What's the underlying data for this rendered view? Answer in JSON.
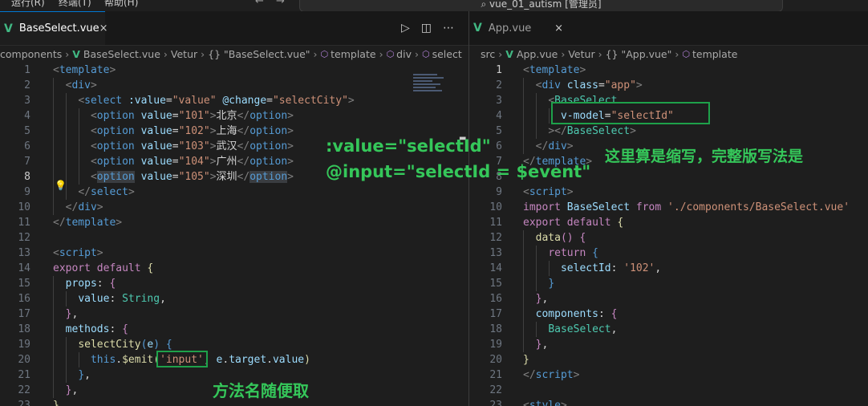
{
  "titlebar": {
    "menu_run": "运行(R)",
    "menu_terminal": "终端(T)",
    "menu_help": "帮助(H)",
    "back_icon": "←",
    "forward_icon": "→",
    "command_center": "vue_01_autism [管理员]"
  },
  "left": {
    "tab_label": "BaseSelect.vue",
    "tab_close": "×",
    "breadcrumb": [
      "components",
      "BaseSelect.vue",
      "Vetur",
      "{} \"BaseSelect.vue\"",
      "template",
      "div",
      "select"
    ],
    "lines": [
      {
        "n": "1",
        "html": "<span class=\"tg\">&lt;</span><span class=\"tn\">template</span><span class=\"tg\">&gt;</span>"
      },
      {
        "n": "2",
        "html": "  <span class=\"tg\">&lt;</span><span class=\"tn\">div</span><span class=\"tg\">&gt;</span>"
      },
      {
        "n": "3",
        "html": "    <span class=\"tg\">&lt;</span><span class=\"tn\">select</span> <span class=\"at\">:value</span><span class=\"tx\">=</span><span class=\"st\">\"value\"</span> <span class=\"at\">@change</span><span class=\"tx\">=</span><span class=\"st\">\"selectCity\"</span><span class=\"tg\">&gt;</span>"
      },
      {
        "n": "4",
        "html": "      <span class=\"tg\">&lt;</span><span class=\"tn\">option</span> <span class=\"at\">value</span><span class=\"tx\">=</span><span class=\"st\">\"101\"</span><span class=\"tg\">&gt;</span><span class=\"tx\">北京</span><span class=\"tg\">&lt;/</span><span class=\"tn\">option</span><span class=\"tg\">&gt;</span>"
      },
      {
        "n": "5",
        "html": "      <span class=\"tg\">&lt;</span><span class=\"tn\">option</span> <span class=\"at\">value</span><span class=\"tx\">=</span><span class=\"st\">\"102\"</span><span class=\"tg\">&gt;</span><span class=\"tx\">上海</span><span class=\"tg\">&lt;/</span><span class=\"tn\">option</span><span class=\"tg\">&gt;</span>"
      },
      {
        "n": "6",
        "html": "      <span class=\"tg\">&lt;</span><span class=\"tn\">option</span> <span class=\"at\">value</span><span class=\"tx\">=</span><span class=\"st\">\"103\"</span><span class=\"tg\">&gt;</span><span class=\"tx\">武汉</span><span class=\"tg\">&lt;/</span><span class=\"tn\">option</span><span class=\"tg\">&gt;</span>"
      },
      {
        "n": "7",
        "html": "      <span class=\"tg\">&lt;</span><span class=\"tn\">option</span> <span class=\"at\">value</span><span class=\"tx\">=</span><span class=\"st\">\"104\"</span><span class=\"tg\">&gt;</span><span class=\"tx\">广州</span><span class=\"tg\">&lt;/</span><span class=\"tn\">option</span><span class=\"tg\">&gt;</span>"
      },
      {
        "n": "8",
        "html": "      <span class=\"tg\">&lt;</span><span class=\"tn hl\">option</span> <span class=\"at\">value</span><span class=\"tx\">=</span><span class=\"st\">\"105\"</span><span class=\"tg\">&gt;</span><span class=\"tx\">深圳</span><span class=\"tg\">&lt;/</span><span class=\"tn hl\">option</span><span class=\"tg\">&gt;</span>"
      },
      {
        "n": "9",
        "html": "    <span class=\"tg\">&lt;/</span><span class=\"tn\">select</span><span class=\"tg\">&gt;</span>"
      },
      {
        "n": "10",
        "html": "  <span class=\"tg\">&lt;/</span><span class=\"tn\">div</span><span class=\"tg\">&gt;</span>"
      },
      {
        "n": "11",
        "html": "<span class=\"tg\">&lt;/</span><span class=\"tn\">template</span><span class=\"tg\">&gt;</span>"
      },
      {
        "n": "12",
        "html": ""
      },
      {
        "n": "13",
        "html": "<span class=\"tg\">&lt;</span><span class=\"tn\">script</span><span class=\"tg\">&gt;</span>"
      },
      {
        "n": "14",
        "html": "<span class=\"kw\">export</span> <span class=\"kw\">default</span> <span class=\"fn\">{</span>"
      },
      {
        "n": "15",
        "html": "  <span class=\"vr\">props</span><span class=\"tx\">: </span><span class=\"kw\">{</span>"
      },
      {
        "n": "16",
        "html": "    <span class=\"vr\">value</span><span class=\"tx\">: </span><span class=\"ty\">String</span><span class=\"tx\">,</span>"
      },
      {
        "n": "17",
        "html": "  <span class=\"kw\">}</span><span class=\"tx\">,</span>"
      },
      {
        "n": "18",
        "html": "  <span class=\"vr\">methods</span><span class=\"tx\">: </span><span class=\"kw\">{</span>"
      },
      {
        "n": "19",
        "html": "    <span class=\"fn\">selectCity</span><span class=\"tn\">(</span><span class=\"vr\">e</span><span class=\"tn\">)</span> <span class=\"tn\">{</span>"
      },
      {
        "n": "20",
        "html": "      <span class=\"tn\">this</span><span class=\"tx\">.</span><span class=\"fn\">$emit</span><span class=\"fn\">(</span><span class=\"st\">'input'</span><span class=\"tx\">, </span><span class=\"vr\">e</span><span class=\"tx\">.</span><span class=\"vr\">target</span><span class=\"tx\">.</span><span class=\"vr\">value</span><span class=\"fn\">)</span>"
      },
      {
        "n": "21",
        "html": "    <span class=\"tn\">}</span><span class=\"tx\">,</span>"
      },
      {
        "n": "22",
        "html": "  <span class=\"kw\">}</span><span class=\"tx\">,</span>"
      },
      {
        "n": "23",
        "html": "<span class=\"fn\">}</span>"
      }
    ]
  },
  "right": {
    "tab_label": "App.vue",
    "tab_close": "×",
    "breadcrumb": [
      "src",
      "App.vue",
      "Vetur",
      "{} \"App.vue\"",
      "template"
    ],
    "lines": [
      {
        "n": "1",
        "html": "<span class=\"tg\">&lt;</span><span class=\"tn\">template</span><span class=\"tg\">&gt;</span>"
      },
      {
        "n": "2",
        "html": "  <span class=\"tg\">&lt;</span><span class=\"tn\">div</span> <span class=\"at\">class</span><span class=\"tx\">=</span><span class=\"st\">\"app\"</span><span class=\"tg\">&gt;</span>"
      },
      {
        "n": "3",
        "html": "    <span class=\"tg\">&lt;</span><span class=\"cmp\">BaseSelect</span>"
      },
      {
        "n": "4",
        "html": "      <span class=\"at\">v-model</span><span class=\"tx\">=</span><span class=\"st\">\"selectId\"</span>"
      },
      {
        "n": "5",
        "html": "    <span class=\"tg\">&gt;&lt;/</span><span class=\"cmp\">BaseSelect</span><span class=\"tg\">&gt;</span>"
      },
      {
        "n": "6",
        "html": "  <span class=\"tg\">&lt;/</span><span class=\"tn\">div</span><span class=\"tg\">&gt;</span>"
      },
      {
        "n": "7",
        "html": "<span class=\"tg\">&lt;/</span><span class=\"tn\">template</span><span class=\"tg\">&gt;</span>"
      },
      {
        "n": "8",
        "html": ""
      },
      {
        "n": "9",
        "html": "<span class=\"tg\">&lt;</span><span class=\"tn\">script</span><span class=\"tg\">&gt;</span>"
      },
      {
        "n": "10",
        "html": "<span class=\"kw\">import</span> <span class=\"vr\">BaseSelect</span> <span class=\"kw\">from</span> <span class=\"st\">'./components/BaseSelect.vue'</span>"
      },
      {
        "n": "11",
        "html": "<span class=\"kw\">export</span> <span class=\"kw\">default</span> <span class=\"fn\">{</span>"
      },
      {
        "n": "12",
        "html": "  <span class=\"fn\">data</span><span class=\"kw\">()</span> <span class=\"kw\">{</span>"
      },
      {
        "n": "13",
        "html": "    <span class=\"kw\">return</span> <span class=\"tn\">{</span>"
      },
      {
        "n": "14",
        "html": "      <span class=\"vr\">selectId</span><span class=\"tx\">: </span><span class=\"st\">'102'</span><span class=\"tx\">,</span>"
      },
      {
        "n": "15",
        "html": "    <span class=\"tn\">}</span>"
      },
      {
        "n": "16",
        "html": "  <span class=\"kw\">}</span><span class=\"tx\">,</span>"
      },
      {
        "n": "17",
        "html": "  <span class=\"vr\">components</span><span class=\"tx\">: </span><span class=\"kw\">{</span>"
      },
      {
        "n": "18",
        "html": "    <span class=\"cmp\">BaseSelect</span><span class=\"tx\">,</span>"
      },
      {
        "n": "19",
        "html": "  <span class=\"kw\">}</span><span class=\"tx\">,</span>"
      },
      {
        "n": "20",
        "html": "<span class=\"fn\">}</span>"
      },
      {
        "n": "21",
        "html": "<span class=\"tg\">&lt;/</span><span class=\"tn\">script</span><span class=\"tg\">&gt;</span>"
      },
      {
        "n": "22",
        "html": ""
      },
      {
        "n": "23",
        "html": "<span class=\"tg\">&lt;</span><span class=\"tn\">style</span><span class=\"tg\">&gt;</span>"
      }
    ]
  },
  "annotations": {
    "value_shorthand": ":value=\"selectId\"",
    "input_shorthand": "@input=\"selectId = $event\"",
    "shorthand_note": "这里算是缩写，完整版写法是",
    "method_name_note": "方法名随便取"
  },
  "colors": {
    "annotation_green": "#35c75a",
    "box_green": "#1ea14a"
  }
}
